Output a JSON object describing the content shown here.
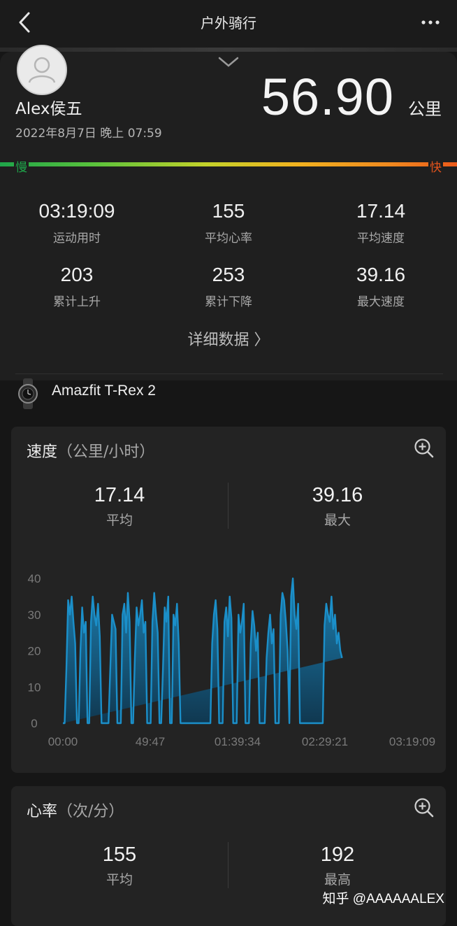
{
  "header": {
    "title": "户外骑行"
  },
  "summary": {
    "username": "Alex侯五",
    "datetime": "2022年8月7日 晚上 07:59",
    "distance": "56.90",
    "distance_unit": "公里",
    "scale_slow": "慢",
    "scale_fast": "快"
  },
  "stats": [
    {
      "value": "03:19:09",
      "label": "运动用时"
    },
    {
      "value": "155",
      "label": "平均心率"
    },
    {
      "value": "17.14",
      "label": "平均速度"
    },
    {
      "value": "203",
      "label": "累计上升"
    },
    {
      "value": "253",
      "label": "累计下降"
    },
    {
      "value": "39.16",
      "label": "最大速度"
    }
  ],
  "detail_link": "详细数据 〉",
  "device": {
    "name": "Amazfit T-Rex 2"
  },
  "speed_card": {
    "title": "速度",
    "unit": "（公里/小时）",
    "avg_value": "17.14",
    "avg_label": "平均",
    "max_value": "39.16",
    "max_label": "最大"
  },
  "chart_data": {
    "type": "area",
    "title": "速度（公里/小时）",
    "xlabel": "",
    "ylabel": "",
    "ylim": [
      0,
      40
    ],
    "yticks": [
      0,
      10,
      20,
      30,
      40
    ],
    "xtick_labels": [
      "00:00",
      "49:47",
      "01:39:34",
      "02:29:21",
      "03:19:09"
    ],
    "x_minutes": [
      0,
      1,
      2,
      3,
      4,
      5,
      6,
      7,
      8,
      9,
      10,
      11,
      12,
      13,
      14,
      15,
      16,
      17,
      18,
      19,
      20,
      21,
      22,
      23,
      24,
      25,
      26,
      27,
      28,
      29,
      30,
      31,
      32,
      33,
      34,
      35,
      36,
      37,
      38,
      39,
      40,
      41,
      42,
      43,
      44,
      45,
      46,
      47,
      48,
      49,
      50,
      51,
      52,
      53,
      54,
      55,
      56,
      57,
      58,
      59,
      60,
      61,
      62,
      63,
      64,
      65,
      66,
      67,
      68,
      69,
      70,
      71,
      72,
      73,
      74,
      75,
      76,
      77,
      78,
      79,
      80,
      81,
      82,
      83,
      84,
      85,
      86,
      87,
      88,
      89,
      90,
      91,
      92,
      93,
      94,
      95,
      96,
      97,
      98,
      99,
      100,
      101,
      102,
      103,
      104,
      105,
      106,
      107,
      108,
      109,
      110,
      111,
      112,
      113,
      114,
      115,
      116,
      117,
      118,
      119,
      120,
      121,
      122,
      123,
      124,
      125,
      126,
      127,
      128,
      129,
      130,
      131,
      132,
      133,
      134,
      135,
      136,
      137,
      138,
      139,
      140,
      141,
      142,
      143,
      144,
      145,
      146,
      147,
      148,
      149,
      150,
      151,
      152,
      153,
      154,
      155,
      156,
      157,
      158,
      159,
      160,
      161,
      162,
      163,
      164,
      165,
      166,
      167,
      168,
      169,
      170,
      171,
      172,
      173,
      174,
      175,
      176,
      177,
      178,
      179,
      180,
      181,
      182,
      183,
      184,
      185,
      186,
      187,
      188,
      189,
      190,
      191,
      192,
      193,
      194,
      195,
      196,
      197,
      198,
      199
    ],
    "speed": [
      0,
      0,
      15,
      34,
      30,
      35,
      28,
      22,
      0,
      0,
      20,
      32,
      25,
      28,
      0,
      0,
      28,
      35,
      30,
      27,
      33,
      24,
      0,
      0,
      0,
      0,
      0,
      15,
      30,
      28,
      26,
      0,
      0,
      0,
      30,
      33,
      25,
      36,
      28,
      0,
      0,
      18,
      32,
      27,
      30,
      34,
      25,
      28,
      0,
      0,
      0,
      28,
      36,
      30,
      25,
      0,
      0,
      15,
      32,
      28,
      35,
      0,
      0,
      30,
      27,
      33,
      22,
      0,
      0,
      0,
      0,
      0,
      0,
      0,
      0,
      0,
      0,
      0,
      0,
      0,
      0,
      0,
      0,
      0,
      0,
      22,
      30,
      34,
      26,
      0,
      0,
      0,
      28,
      32,
      24,
      35,
      29,
      0,
      0,
      0,
      30,
      25,
      28,
      33,
      0,
      0,
      0,
      22,
      31,
      27,
      20,
      25,
      0,
      0,
      0,
      0,
      18,
      25,
      30,
      22,
      26,
      0,
      0,
      0,
      30,
      36,
      34,
      28,
      20,
      0,
      35,
      40,
      30,
      26,
      33,
      0,
      0,
      0,
      0,
      0,
      0,
      0,
      0,
      0,
      0,
      0,
      0,
      0,
      0,
      27,
      33,
      30,
      28,
      35,
      26,
      30,
      22,
      25,
      20,
      18
    ],
    "series": [
      {
        "name": "",
        "color": "#1b8fc9"
      }
    ]
  },
  "hr_card": {
    "title": "心率",
    "unit": "（次/分）",
    "avg_value": "155",
    "avg_label": "平均",
    "max_value": "192",
    "max_label": "最高"
  },
  "watermark": "知乎 @AAAAAALEX",
  "colors": {
    "accent": "#1b8fc9",
    "background": "#161616",
    "card": "#232323",
    "slow": "#1fa54a",
    "fast": "#e3531c"
  },
  "icons": {
    "back": "chevron-left-icon",
    "more": "more-dots-icon",
    "collapse": "chevron-down-icon",
    "zoom": "zoom-in-icon",
    "avatar": "person-icon",
    "device": "watch-icon"
  }
}
